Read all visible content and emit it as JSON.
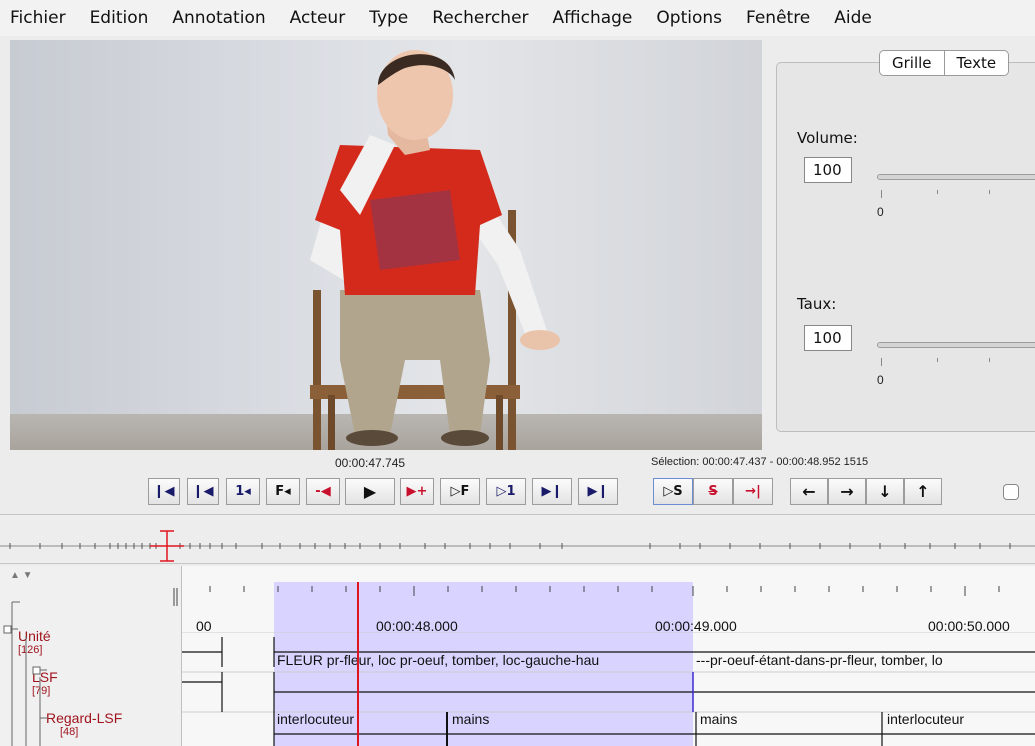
{
  "menu": [
    "Fichier",
    "Edition",
    "Annotation",
    "Acteur",
    "Type",
    "Rechercher",
    "Affichage",
    "Options",
    "Fenêtre",
    "Aide"
  ],
  "side_panel": {
    "tabs": [
      "Grille",
      "Texte"
    ],
    "volume_label": "Volume:",
    "volume_value": "100",
    "volume_min": "0",
    "rate_label": "Taux:",
    "rate_value": "100",
    "rate_min": "0"
  },
  "player": {
    "time": "00:00:47.745",
    "selection": "Sélection: 00:00:47.437 - 00:00:48.952  1515"
  },
  "controls": {
    "go_begin": "◂◂",
    "prev_frame": "F◂",
    "one": "1◂",
    "play": "▶",
    "next_f": "▷F",
    "next_one": "▷1",
    "sel_play": "▷S",
    "sel_clear": "S",
    "arrow_left": "←",
    "arrow_right": "→",
    "arrow_down": "↓",
    "arrow_up": "↑"
  },
  "timeline": {
    "ruler_left": "00",
    "ruler_labels": [
      "00:00:48.000",
      "00:00:49.000",
      "00:00:50.000"
    ],
    "tiers": [
      {
        "name": "Unité",
        "count": "[126]"
      },
      {
        "name": "LSF",
        "count": "[79]"
      },
      {
        "name": "Regard-LSF",
        "count": "[48]"
      }
    ],
    "annotations": {
      "lsf_1": "FLEUR pr-fleur, loc pr-oeuf, tomber, loc-gauche-hau",
      "lsf_2": "---pr-oeuf-étant-dans-pr-fleur, tomber, lo",
      "regard_1": "interlocuteur",
      "regard_2": "mains",
      "regard_3": "mains",
      "regard_4": "interlocuteur"
    }
  },
  "colors": {
    "selection": "#d8d4ff",
    "crosshair": "#e0141e",
    "tier_name": "#a0141e"
  }
}
